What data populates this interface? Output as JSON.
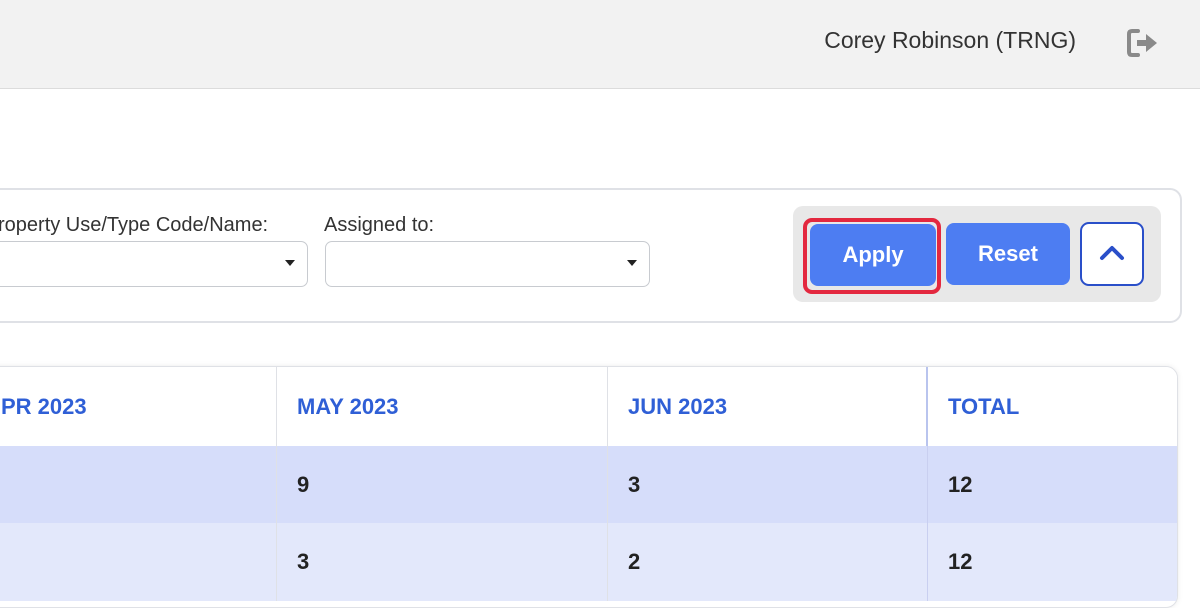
{
  "header": {
    "user_name": "Corey Robinson (TRNG)",
    "logout_icon": "logout-icon"
  },
  "filters": {
    "property_use_label": "roperty Use/Type Code/Name:",
    "property_use_value": "",
    "assigned_to_label": "Assigned to:",
    "assigned_to_value": "",
    "apply_label": "Apply",
    "reset_label": "Reset",
    "collapse_icon": "chevron-up-icon",
    "highlight_color": "#e3283f"
  },
  "table": {
    "columns": [
      "PR 2023",
      "MAY 2023",
      "JUN 2023",
      "TOTAL"
    ],
    "rows": [
      [
        "",
        "9",
        "3",
        "12"
      ],
      [
        "",
        "3",
        "2",
        "12"
      ]
    ]
  },
  "colors": {
    "accent": "#4d7df2",
    "header_text": "#2f5fd6",
    "row_alt_1": "#d6ddfa",
    "row_alt_2": "#e3e8fb"
  }
}
